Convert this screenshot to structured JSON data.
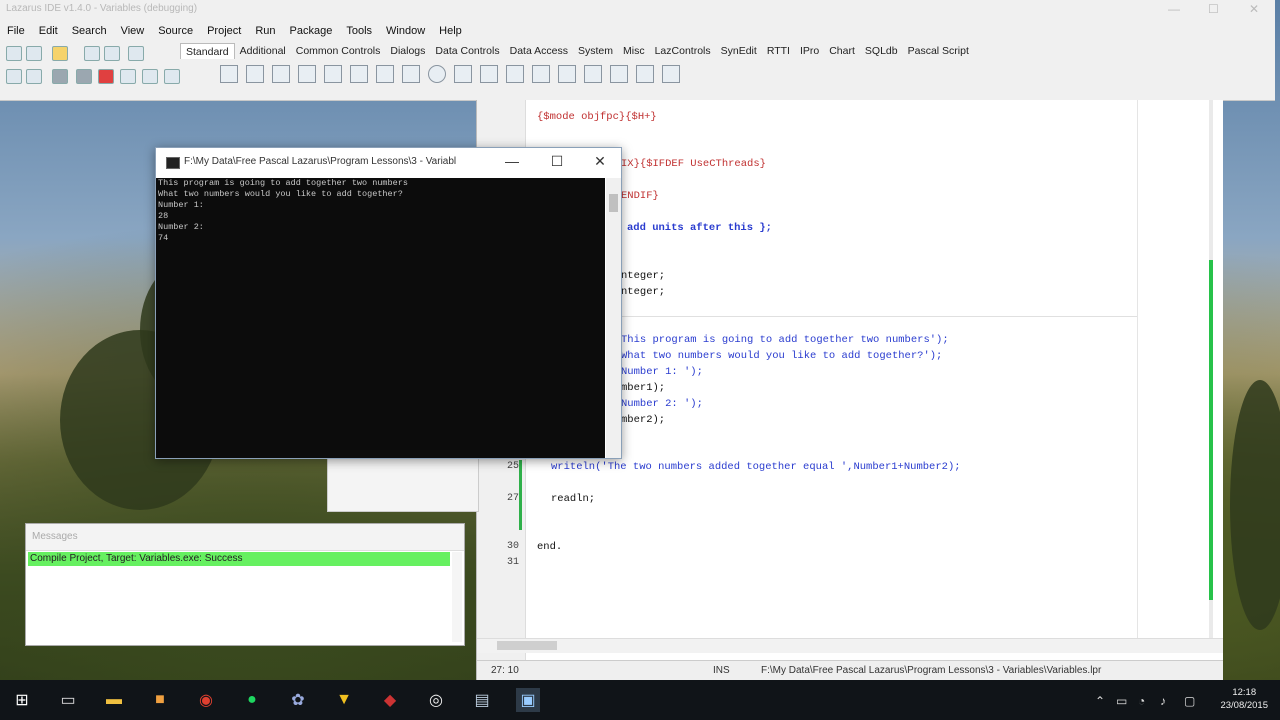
{
  "ide": {
    "title": "Lazarus IDE v1.4.0 - Variables (debugging)",
    "menu": [
      "File",
      "Edit",
      "Search",
      "View",
      "Source",
      "Project",
      "Run",
      "Package",
      "Tools",
      "Window",
      "Help"
    ],
    "palette_tabs": [
      "Standard",
      "Additional",
      "Common Controls",
      "Dialogs",
      "Data Controls",
      "Data Access",
      "System",
      "Misc",
      "LazControls",
      "SynEdit",
      "RTTI",
      "IPro",
      "Chart",
      "SQLdb",
      "Pascal Script"
    ]
  },
  "editor": {
    "lines": [
      {
        "text": "{$mode objfpc}{$H+}",
        "cls": "kw-dir"
      },
      {
        "text": "IX}{$IFDEF UseCThreads}",
        "cls": "kw-dir"
      },
      {
        "text": "ENDIF}",
        "cls": "kw-dir"
      },
      {
        "text": "add units after this };",
        "cls": "str"
      },
      {
        "text": "nteger;",
        "cls": "kw"
      },
      {
        "text": "nteger;",
        "cls": "kw"
      },
      {
        "text": "This program is going to add together two numbers');",
        "cls": "str"
      },
      {
        "text": "What two numbers would you like to add together?');",
        "cls": "str"
      },
      {
        "text": "Number 1: ');",
        "cls": "str"
      },
      {
        "text": "mber1);",
        "cls": "kw"
      },
      {
        "text": "Number 2: ');",
        "cls": "str"
      },
      {
        "text": "mber2);",
        "cls": "kw"
      },
      {
        "text": "writeln('The two numbers added together equal ',Number1+Number2);",
        "cls": "str"
      },
      {
        "text": "readln;",
        "cls": "kw"
      },
      {
        "text": "end.",
        "cls": "kw"
      }
    ],
    "line_numbers": [
      "25",
      "27",
      "30",
      "31"
    ],
    "status": {
      "position": "27: 10",
      "mode": "INS",
      "file": "F:\\My Data\\Free Pascal Lazarus\\Program Lessons\\3 - Variables\\Variables.lpr"
    }
  },
  "console": {
    "title": "F:\\My Data\\Free Pascal Lazarus\\Program Lessons\\3 - Variabl",
    "lines": [
      "This program is going to add together two numbers",
      "What two numbers would you like to add together?",
      "Number 1:",
      "28",
      "Number 2:",
      "74"
    ]
  },
  "messages": {
    "title": "Messages",
    "line": "Compile Project, Target: Variables.exe: Success"
  },
  "taskbar": {
    "time": "12:18",
    "date": "23/08/2015"
  }
}
